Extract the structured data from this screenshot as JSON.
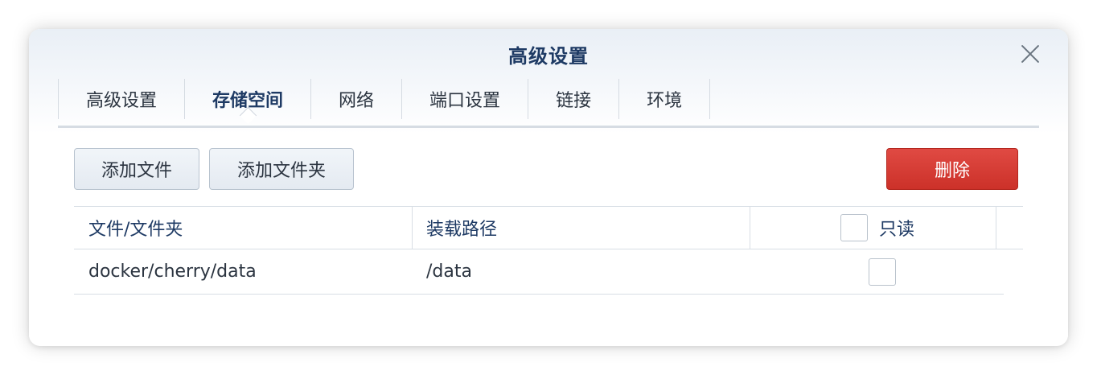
{
  "dialog": {
    "title": "高级设置",
    "close_icon": "close-icon"
  },
  "tabs": [
    {
      "label": "高级设置",
      "active": false
    },
    {
      "label": "存储空间",
      "active": true
    },
    {
      "label": "网络",
      "active": false
    },
    {
      "label": "端口设置",
      "active": false
    },
    {
      "label": "链接",
      "active": false
    },
    {
      "label": "环境",
      "active": false
    }
  ],
  "toolbar": {
    "add_file_label": "添加文件",
    "add_folder_label": "添加文件夹",
    "delete_label": "删除"
  },
  "table": {
    "columns": {
      "path": "文件/文件夹",
      "mount_path": "装载路径",
      "readonly": "只读"
    },
    "rows": [
      {
        "path": "docker/cherry/data",
        "mount_path": "/data",
        "readonly": false
      }
    ]
  },
  "colors": {
    "title": "#1e3a64",
    "danger": "#d63a32"
  }
}
